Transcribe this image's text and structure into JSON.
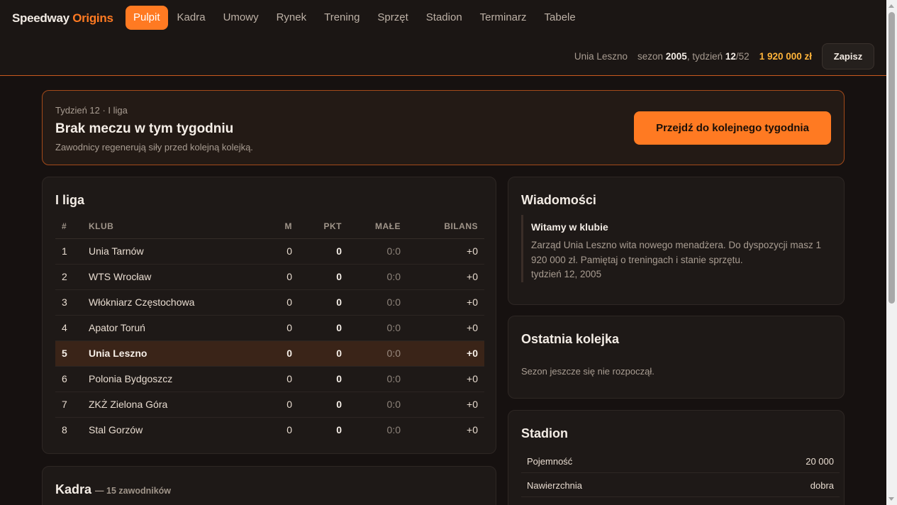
{
  "app": {
    "logo_part1": "Speedway",
    "logo_part2": "Origins"
  },
  "nav": {
    "items": [
      "Pulpit",
      "Kadra",
      "Umowy",
      "Rynek",
      "Trening",
      "Sprzęt",
      "Stadion",
      "Terminarz",
      "Tabele"
    ],
    "active": "Pulpit"
  },
  "status": {
    "club": "Unia Leszno",
    "season_label": "sezon",
    "season": "2005",
    "week_label": ", tydzień",
    "week": "12",
    "week_total": "/52",
    "money": "1 920 000 zł",
    "save_label": "Zapisz"
  },
  "banner": {
    "kicker": "Tydzień 12 · I liga",
    "title": "Brak meczu w tym tygodniu",
    "subtitle": "Zawodnicy regenerują siły przed kolejną kolejką.",
    "button": "Przejdź do kolejnego tygodnia"
  },
  "league": {
    "title": "I liga",
    "headers": [
      "#",
      "KLUB",
      "M",
      "PKT",
      "MAŁE",
      "BILANS"
    ],
    "rows": [
      [
        "1",
        "Unia Tarnów",
        "0",
        "0",
        "0:0",
        "+0"
      ],
      [
        "2",
        "WTS Wrocław",
        "0",
        "0",
        "0:0",
        "+0"
      ],
      [
        "3",
        "Włókniarz Częstochowa",
        "0",
        "0",
        "0:0",
        "+0"
      ],
      [
        "4",
        "Apator Toruń",
        "0",
        "0",
        "0:0",
        "+0"
      ],
      [
        "5",
        "Unia Leszno",
        "0",
        "0",
        "0:0",
        "+0"
      ],
      [
        "6",
        "Polonia Bydgoszcz",
        "0",
        "0",
        "0:0",
        "+0"
      ],
      [
        "7",
        "ZKŻ Zielona Góra",
        "0",
        "0",
        "0:0",
        "+0"
      ],
      [
        "8",
        "Stal Gorzów",
        "0",
        "0",
        "0:0",
        "+0"
      ]
    ],
    "own_club": "Unia Leszno"
  },
  "kadra": {
    "title": "Kadra",
    "subtitle": "— 15 zawodników"
  },
  "news": {
    "title": "Wiadomości",
    "item_title": "Witamy w klubie",
    "item_body": "Zarząd Unia Leszno wita nowego menadżera. Do dyspozycji masz 1 920 000 zł. Pamiętaj o treningach i stanie sprzętu.",
    "item_date": "tydzień 12, 2005"
  },
  "last_round": {
    "title": "Ostatnia kolejka",
    "text": "Sezon jeszcze się nie rozpoczął."
  },
  "stadium": {
    "title": "Stadion",
    "rows": [
      {
        "label": "Pojemność",
        "value": "20 000"
      },
      {
        "label": "Nawierzchnia",
        "value": "dobra"
      }
    ]
  },
  "colors": {
    "accent": "#ff7a22",
    "money": "#ffb43a",
    "background": "#161110"
  }
}
